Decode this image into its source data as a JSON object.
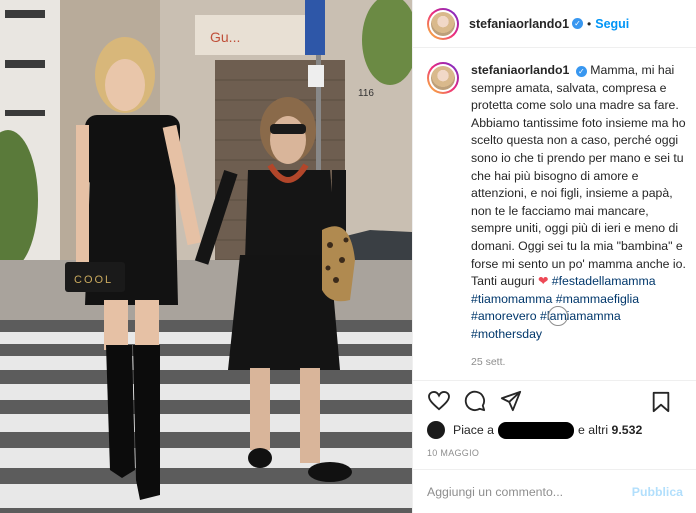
{
  "post": {
    "username": "stefaniaorlando1",
    "verified_icon": "verified-badge-icon",
    "dot": "•",
    "follow_label": "Segui",
    "photo": {
      "storefront_sign": "Gu...",
      "building_number": "116",
      "bag_text": "COOL"
    }
  },
  "caption": {
    "username": "stefaniaorlando1",
    "text": "Mamma, mi hai sempre amata, salvata, compresa e protetta come solo una madre sa fare. Abbiamo tantissime foto insieme ma ho scelto questa non a caso, perché oggi sono io che ti prendo per mano e sei tu che hai più bisogno di amore e attenzioni, e noi figli, insieme a papà, non te le facciamo mai mancare, sempre uniti, oggi più di ieri e meno di domani. Oggi sei tu la mia \"bambina\" e forse mi sento un po' mamma anche io. Tanti auguri",
    "heart": "❤",
    "hashtags": "#festadellamamma #tiamomamma #mammaefiglia #amorevero #lamiamamma #mothersday",
    "date": "25 sett."
  },
  "likes": {
    "prefix": "Piace a",
    "suffix": "e altri",
    "count": "9.532"
  },
  "post_date": "10 MAGGIO",
  "comment": {
    "placeholder": "Aggiungi un commento...",
    "publish_label": "Pubblica"
  },
  "colors": {
    "accent": "#0095f6",
    "verified": "#3897f0",
    "heart": "#ed4956",
    "hashtag": "#00376b",
    "muted": "#8e8e8e"
  }
}
